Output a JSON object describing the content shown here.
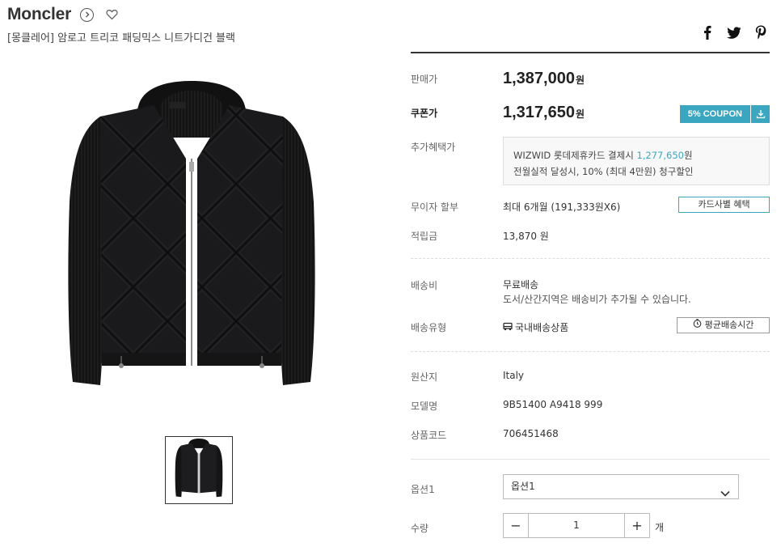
{
  "brand": {
    "name": "Moncler"
  },
  "product": {
    "title": "[몽클레어] 암로고 트리코 패딩믹스 니트가디건 블랙"
  },
  "share": {
    "facebook": "facebook-icon",
    "twitter": "twitter-icon",
    "pinterest": "pinterest-icon"
  },
  "pricing": {
    "sale_label": "판매가",
    "sale_price": "1,387,000",
    "currency": "원",
    "coupon_label": "쿠폰가",
    "coupon_price": "1,317,650",
    "coupon_button": "5% COUPON",
    "extra_label": "추가혜택가",
    "extra_line1_prefix": "WIZWID 롯데제휴카드 결제시 ",
    "extra_line1_amount": "1,277,650",
    "extra_line1_suffix": "원",
    "extra_line2": "전월실적 달성시, 10% (최대 4만원) 청구할인"
  },
  "installment": {
    "label": "무이자 할부",
    "value": "최대 6개월 (191,333원X6)",
    "button": "카드사별 혜택"
  },
  "points": {
    "label": "적립금",
    "value": "13,870 원"
  },
  "shipping": {
    "fee_label": "배송비",
    "fee_value": "무료배송",
    "fee_note": "도서/산간지역은 배송비가 추가될 수 있습니다.",
    "type_label": "배송유형",
    "type_value": "국내배송상품",
    "avg_button": "평균배송시간"
  },
  "details": {
    "origin_label": "원산지",
    "origin_value": "Italy",
    "model_label": "모델명",
    "model_value": "9B51400 A9418 999",
    "code_label": "상품코드",
    "code_value": "706451468"
  },
  "options": {
    "label": "옵션1",
    "selected": "옵션1"
  },
  "quantity": {
    "label": "수량",
    "value": "1",
    "unit": "개",
    "minus": "−",
    "plus": "+"
  },
  "colors": {
    "accent": "#3aa6bf",
    "text": "#222222"
  }
}
